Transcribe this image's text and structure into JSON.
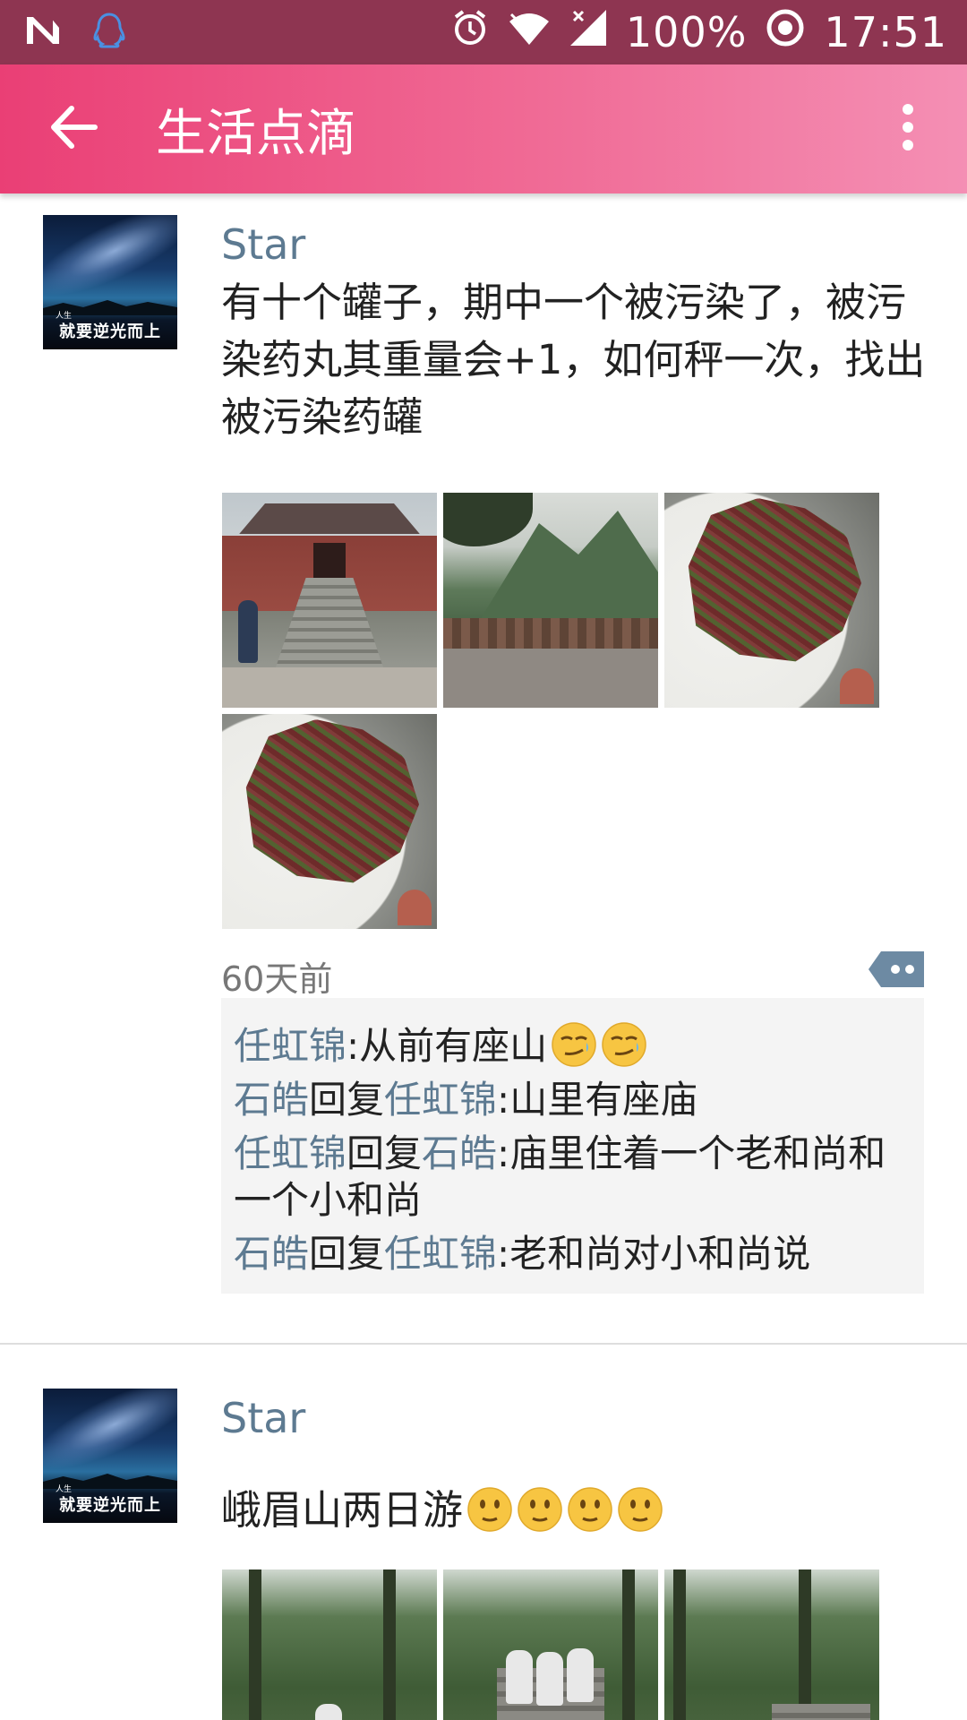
{
  "status_bar": {
    "battery_percent": "100%",
    "clock": "17:51",
    "icons": [
      "n-logo-icon",
      "qq-penguin-icon",
      "alarm-icon",
      "wifi-icon",
      "cell-signal-icon",
      "sync-ring-icon"
    ]
  },
  "app_bar": {
    "title": "生活点滴",
    "back_icon": "arrow-back-icon",
    "more_icon": "more-vert-icon",
    "colors": {
      "gradient_start": "#ea3f75",
      "gradient_end": "#f48fb4",
      "status_bar": "#8e3551"
    }
  },
  "posts": [
    {
      "username": "Star",
      "avatar_text": "就要逆光而上",
      "avatar_small": "人生",
      "text": "有十个罐子，期中一个被污染了，被污染药丸其重量会+1，如何秤一次，找出被污染药罐",
      "photos": [
        "temple-photo",
        "mountain-railing-photo",
        "salad-photo",
        "salad-photo"
      ],
      "time": "60天前",
      "comments": [
        {
          "name": "任虹锦",
          "reply_to": "",
          "text": "从前有座山",
          "emoji": [
            "smirk-emoji",
            "smirk-emoji"
          ]
        },
        {
          "name": "石皓",
          "reply_label": "回复",
          "reply_to": "任虹锦",
          "text": "山里有座庙"
        },
        {
          "name": "任虹锦",
          "reply_label": "回复",
          "reply_to": "石皓",
          "text": "庙里住着一个老和尚和一个小和尚"
        },
        {
          "name": "石皓",
          "reply_label": "回复",
          "reply_to": "任虹锦",
          "text": "老和尚对小和尚说"
        }
      ]
    },
    {
      "username": "Star",
      "avatar_text": "就要逆光而上",
      "avatar_small": "人生",
      "text": "峨眉山两日游",
      "emoji": [
        "shy-smile-emoji",
        "shy-smile-emoji",
        "shy-smile-emoji",
        "shy-smile-emoji"
      ],
      "photos": [
        "forest-path-photo",
        "group-stairs-photo",
        "forest-trail-photo"
      ]
    }
  ],
  "colors": {
    "name_link": "#5d7a91",
    "comment_bg": "#f4f4f4",
    "time_text": "#777777"
  }
}
